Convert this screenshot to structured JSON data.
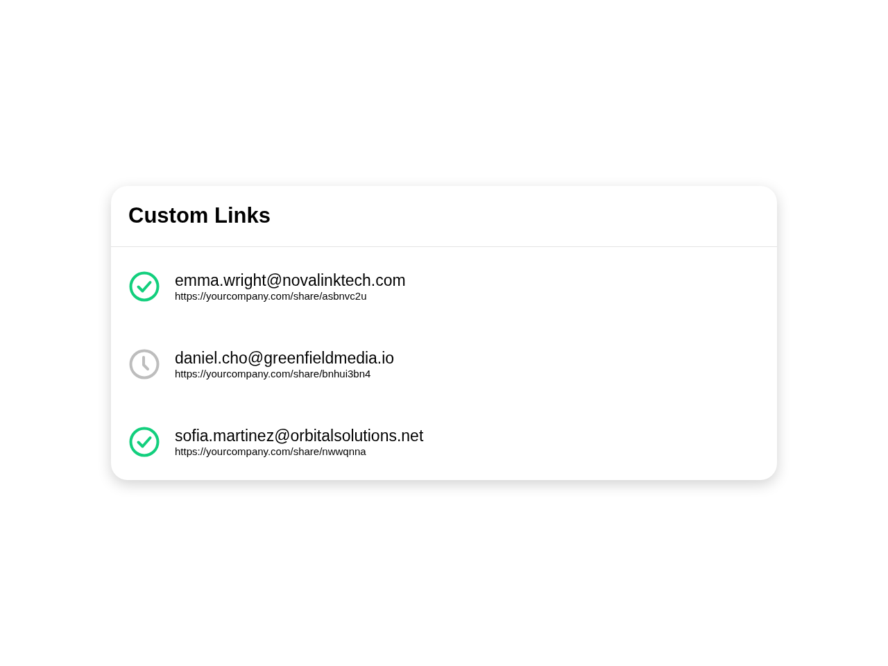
{
  "card": {
    "title": "Custom Links"
  },
  "links": [
    {
      "completed": true,
      "email": "emma.wright@novalinktech.com",
      "url": "https://yourcompany.com/share/asbnvc2u"
    },
    {
      "completed": false,
      "email": "daniel.cho@greenfieldmedia.io",
      "url": "https://yourcompany.com/share/bnhui3bn4"
    },
    {
      "completed": true,
      "email": "sofia.martinez@orbitalsolutions.net",
      "url": "https://yourcompany.com/share/nwwqnna"
    }
  ]
}
